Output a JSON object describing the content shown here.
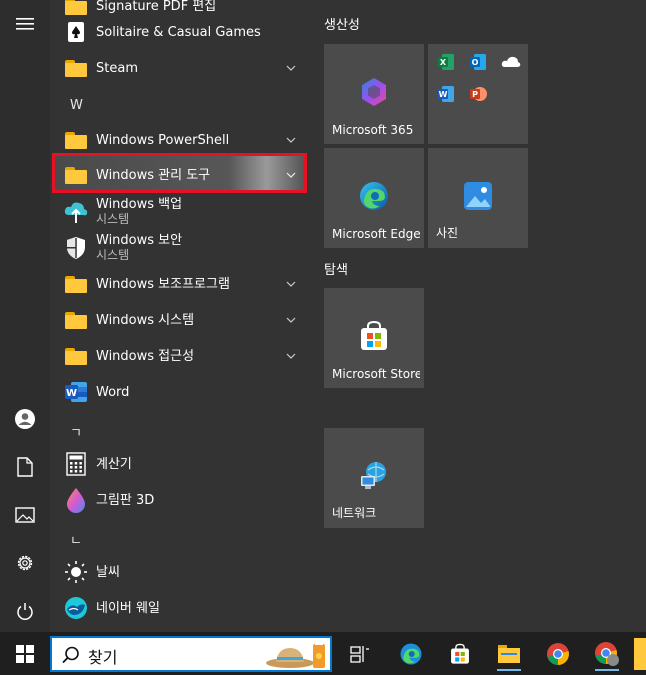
{
  "applist": {
    "top_partial": "Signature PDF 편집",
    "items": [
      {
        "label": "Solitaire & Casual Games"
      },
      {
        "label": "Steam"
      },
      {
        "label": "Windows PowerShell"
      },
      {
        "label": "Windows 관리 도구"
      },
      {
        "label": "Windows 백업",
        "sub": "시스템"
      },
      {
        "label": "Windows 보안",
        "sub": "시스템"
      },
      {
        "label": "Windows 보조프로그램"
      },
      {
        "label": "Windows 시스템"
      },
      {
        "label": "Windows 접근성"
      },
      {
        "label": "Word"
      },
      {
        "label": "계산기"
      },
      {
        "label": "그림판 3D"
      },
      {
        "label": "날씨"
      },
      {
        "label": "네이버 웨일"
      }
    ],
    "letters": [
      "W",
      "ㄱ",
      "ㄴ"
    ]
  },
  "tiles": {
    "group1": "생산성",
    "group2": "탐색",
    "microsoft365": "Microsoft 365",
    "edge": "Microsoft Edge",
    "photos": "사진",
    "store": "Microsoft Store",
    "network": "네트워크"
  },
  "taskbar": {
    "search_text": "찾기"
  },
  "colors": {
    "highlight": "#e81123",
    "folder": "#ffc83d",
    "accent": "#0078d4"
  }
}
